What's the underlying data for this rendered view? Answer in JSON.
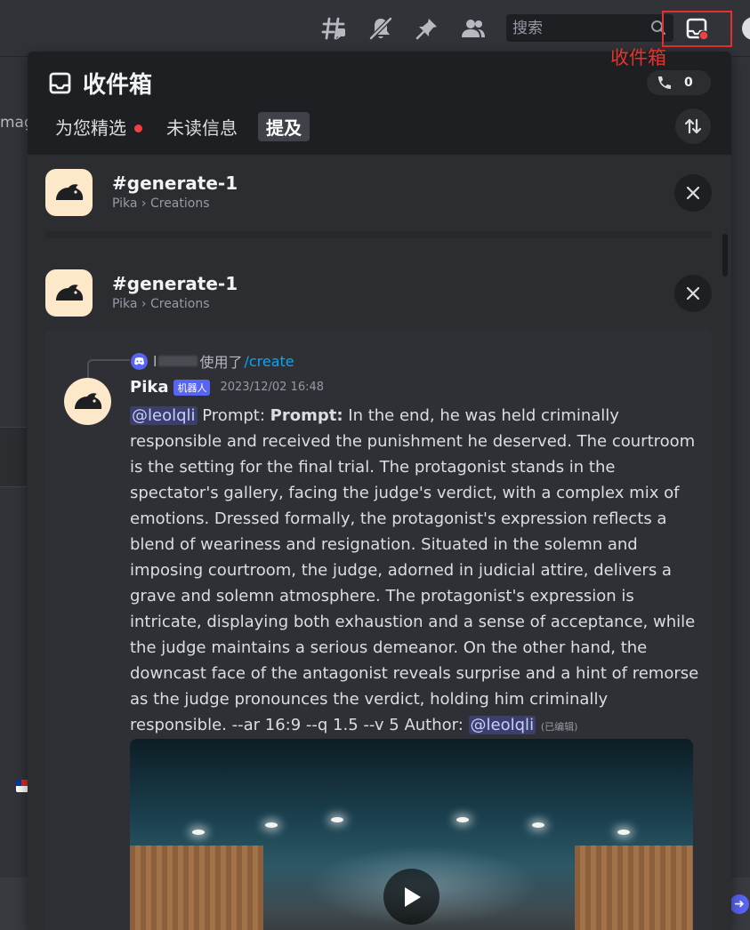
{
  "toolbar": {
    "icons": [
      "threads-icon",
      "notification-muted-icon",
      "pin-icon",
      "members-icon"
    ],
    "search_placeholder": "搜索",
    "inbox_annotation": "收件箱"
  },
  "background": {
    "left_fragment": "mag"
  },
  "inbox": {
    "title": "收件箱",
    "call_count": "0",
    "tabs": [
      {
        "label": "为您精选",
        "has_dot": true,
        "active": false
      },
      {
        "label": "未读信息",
        "has_dot": false,
        "active": false
      },
      {
        "label": "提及",
        "has_dot": false,
        "active": true
      }
    ],
    "items": [
      {
        "channel": "#generate-1",
        "path": "Pika › Creations"
      },
      {
        "channel": "#generate-1",
        "path": "Pika › Creations"
      }
    ]
  },
  "message": {
    "reply_user_prefix": "l",
    "reply_used": "使用了",
    "reply_command": "/create",
    "author": "Pika",
    "bot_tag": "机器人",
    "timestamp": "2023/12/02 16:48",
    "mention": "@leolqli",
    "prompt_label": "Prompt:",
    "prompt_bold": "Prompt:",
    "prompt_text": "In the end, he was held criminally responsible and received the punishment he deserved.  The courtroom is the setting for the final trial. The protagonist stands in the spectator's gallery, facing the judge's verdict, with a complex mix of emotions. Dressed formally, the protagonist's expression reflects a blend of weariness and resignation.  Situated in the solemn and imposing courtroom, the judge, adorned in judicial attire, delivers a grave and solemn atmosphere. The protagonist's expression is intricate, displaying both exhaustion and a sense of acceptance, while the judge maintains a serious demeanor. On the other hand, the downcast face of the antagonist reveals surprise and a hint of remorse as the judge pronounces the verdict, holding him criminally responsible. --ar 16:9 --q 1.5 --v 5  Author:",
    "author_mention": "@leolqli",
    "edited": "(已编辑)"
  },
  "colors": {
    "accent": "#5865f2",
    "annotation_red": "#e5312d",
    "link": "#00a8fc"
  }
}
